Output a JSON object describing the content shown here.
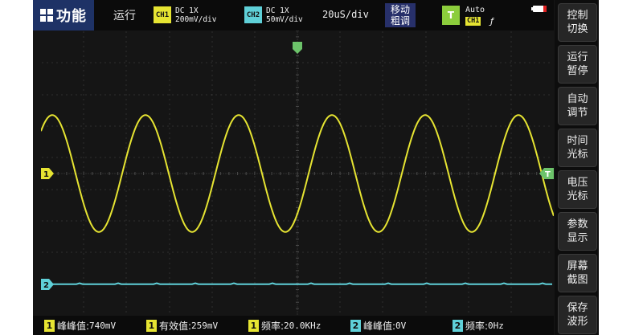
{
  "top": {
    "menu_label": "功能",
    "run_status": "运行",
    "ch1": {
      "badge": "CH1",
      "coupling": "DC  1X",
      "scale": "200mV/div"
    },
    "ch2": {
      "badge": "CH2",
      "coupling": "DC  1X",
      "scale": "50mV/div"
    },
    "timebase": "20uS/div",
    "move_button": {
      "line1": "移动",
      "line2": "粗调"
    },
    "trigger": {
      "badge": "T",
      "mode": "Auto",
      "source": "CH1",
      "edge": "ƒ"
    },
    "battery_icon": "battery-low-icon"
  },
  "side_menu": [
    {
      "line1": "控制",
      "line2": "切换"
    },
    {
      "line1": "运行",
      "line2": "暂停"
    },
    {
      "line1": "自动",
      "line2": "调节"
    },
    {
      "line1": "时间",
      "line2": "光标"
    },
    {
      "line1": "电压",
      "line2": "光标"
    },
    {
      "line1": "参数",
      "line2": "显示"
    },
    {
      "line1": "屏幕",
      "line2": "截图"
    },
    {
      "line1": "保存",
      "line2": "波形"
    }
  ],
  "markers": {
    "ch1": "1",
    "ch2": "2",
    "trigger_level": "T"
  },
  "waveforms": {
    "ch1": {
      "shape": "sine",
      "cycles_on_screen": 5.5,
      "amplitude_divisions": 3.7,
      "offset_divisions": 0
    },
    "ch2": {
      "shape": "flat",
      "level_divisions": -3.5
    }
  },
  "measurements": [
    {
      "ch": "1",
      "label": "峰峰值:",
      "value": "740mV"
    },
    {
      "ch": "1",
      "label": "有效值:",
      "value": "259mV"
    },
    {
      "ch": "1",
      "label": "频率:",
      "value": "20.0KHz"
    },
    {
      "ch": "2",
      "label": "峰峰值:",
      "value": "0V"
    },
    {
      "ch": "2",
      "label": "频率:",
      "value": "0Hz"
    }
  ],
  "colors": {
    "ch1": "#e6e432",
    "ch2": "#5fd0d8",
    "trigger": "#6cc36a",
    "grid": "#4a4a4a",
    "button_blue": "#27306a"
  }
}
